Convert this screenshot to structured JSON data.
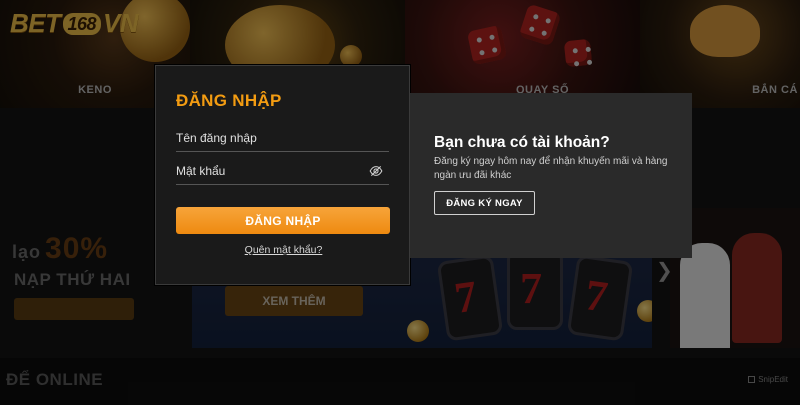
{
  "brand": {
    "logo_left": "BET",
    "logo_num": "168",
    "logo_right": "VN"
  },
  "games": [
    {
      "label": "KENO"
    },
    {
      "label": ""
    },
    {
      "label": "QUAY SỐ"
    },
    {
      "label": "BẮN CÁ"
    }
  ],
  "promo": {
    "prefix": "lạo",
    "percent": "30%",
    "subtitle": "NẠP THỨ HAI"
  },
  "banner": {
    "xem_them": "XEM THÊM"
  },
  "section_title": "ĐỂ ONLINE",
  "watermark": "SnipEdit",
  "login": {
    "title": "ĐĂNG NHẬP",
    "username_placeholder": "Tên đăng nhập",
    "password_placeholder": "Mật khẩu",
    "submit_label": "ĐĂNG NHẬP",
    "forgot_label": "Quên mật khẩu?",
    "accent_color": "#f39c12"
  },
  "signup": {
    "title": "Bạn chưa có tài khoản?",
    "description": "Đăng ký ngay hôm nay để nhận khuyến mãi và hàng ngàn ưu đãi khác",
    "button_label": "ĐĂNG KÝ NGAY"
  }
}
